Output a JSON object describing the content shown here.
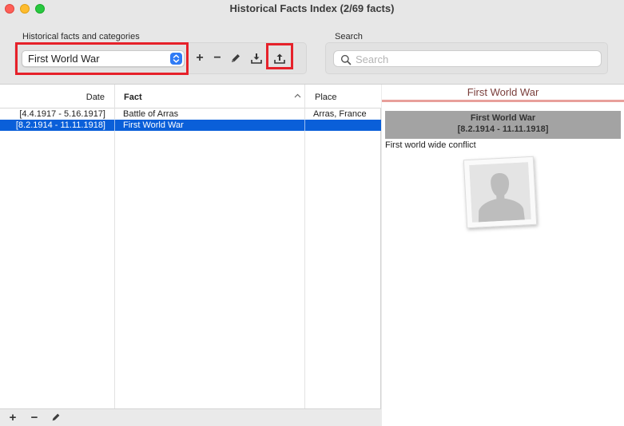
{
  "window": {
    "title": "Historical Facts Index (2/69 facts)"
  },
  "toolbar": {
    "categories_label": "Historical facts and categories",
    "category_selected": "First World War",
    "add_label": "+",
    "remove_label": "−",
    "search_label": "Search",
    "search_placeholder": "Search",
    "search_value": ""
  },
  "table": {
    "columns": {
      "date": "Date",
      "fact": "Fact",
      "place": "Place"
    },
    "sorted_column": "Fact",
    "rows": [
      {
        "date": "[4.4.1917 - 5.16.1917]",
        "fact": "Battle of Arras",
        "place": "Arras, France",
        "selected": false
      },
      {
        "date": "[8.2.1914 - 11.11.1918]",
        "fact": "First World War",
        "place": "",
        "selected": true
      }
    ]
  },
  "bottom_bar": {
    "add_label": "+",
    "remove_label": "−"
  },
  "detail": {
    "title": "First World War",
    "box_name": "First World War",
    "box_dates": "[8.2.1914 - 11.11.1918]",
    "description": "First world wide conflict",
    "photo_icon": "person-silhouette-icon"
  },
  "colors": {
    "selection": "#0a5fd9",
    "highlight_frame": "#e6212a",
    "detail_accent": "#e8a09b",
    "detail_title": "#7a3e3b",
    "popup_stepper": "#2f7bf5"
  }
}
